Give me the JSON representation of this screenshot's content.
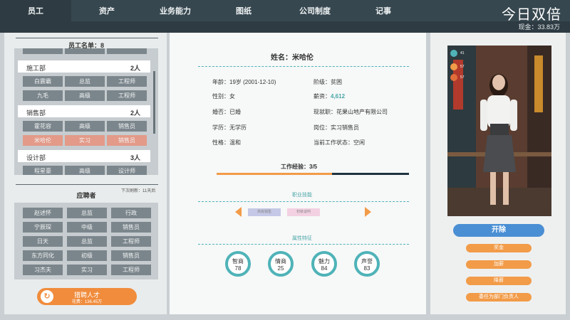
{
  "tabs": [
    {
      "label": "员工",
      "active": true
    },
    {
      "label": "资产"
    },
    {
      "label": "业务能力"
    },
    {
      "label": "图纸"
    },
    {
      "label": "公司制度"
    },
    {
      "label": "记事"
    }
  ],
  "brand": "今日双倍",
  "cash": "现金：33.83万",
  "staff": {
    "title": "员工名单：8",
    "departments": [
      {
        "name": "施工部",
        "count": "2人"
      },
      {
        "name": "销售部",
        "count": "2人"
      },
      {
        "name": "设计部",
        "count": "3人"
      }
    ],
    "employees": [
      {
        "name": "白震霸",
        "level": "总监",
        "role": "工程师"
      },
      {
        "name": "九毛",
        "level": "高级",
        "role": "工程师"
      },
      {
        "name": "霍花容",
        "level": "高级",
        "role": "销售员"
      },
      {
        "name": "米哈伦",
        "level": "实习",
        "role": "销售员"
      },
      {
        "name": "程星豪",
        "level": "高级",
        "role": "设计师"
      }
    ]
  },
  "next_refresh": "下次刷新：11天后",
  "applicants": {
    "title": "应聘者",
    "rows": [
      {
        "name": "赵述怀",
        "level": "总监",
        "role": "行政"
      },
      {
        "name": "宁辰琛",
        "level": "中级",
        "role": "销售员"
      },
      {
        "name": "日天",
        "level": "总监",
        "role": "工程师"
      },
      {
        "name": "东方同化",
        "level": "初级",
        "role": "销售员"
      },
      {
        "name": "习杰夫",
        "level": "实习",
        "role": "工程师"
      }
    ]
  },
  "recruit": {
    "label": "猎聘人才",
    "cost": "花费：136.45万"
  },
  "detail": {
    "name": "姓名：米哈伦",
    "age": "年龄：19岁 (2001-12-10)",
    "class": "阶级：贫困",
    "gender": "性别：女",
    "salary_k": "薪资：",
    "salary_v": "4,612",
    "marital": "婚否：已婚",
    "company": "现就职：花果山地产有限公司",
    "education": "学历：无学历",
    "position": "岗位：实习销售员",
    "personality": "性格：温和",
    "status": "当前工作状态：空闲",
    "experience": "工作经验：3/5",
    "experience_fraction": 0.6,
    "skills_title": "职业技能",
    "skills": [
      "高级销售",
      "初级谈判"
    ],
    "attrs_title": "属性特征",
    "attrs": [
      {
        "name": "智商",
        "value": "78"
      },
      {
        "name": "情商",
        "value": "25"
      },
      {
        "name": "魅力",
        "value": "84"
      },
      {
        "name": "声誉",
        "value": "83"
      }
    ]
  },
  "vitals": [
    {
      "icon": "heartbeat-icon",
      "value": "41"
    },
    {
      "icon": "mood-icon",
      "value": "57"
    },
    {
      "icon": "energy-icon",
      "value": "57"
    }
  ],
  "actions": {
    "fire": "开除",
    "bonus": "奖金",
    "raise": "加薪",
    "cut": "降薪",
    "assign": "委任为部门负责人"
  },
  "colors": {
    "accent": "#4fb3b8",
    "orange": "#f29b48",
    "blue": "#4a8fd4",
    "dark": "#37474f"
  }
}
